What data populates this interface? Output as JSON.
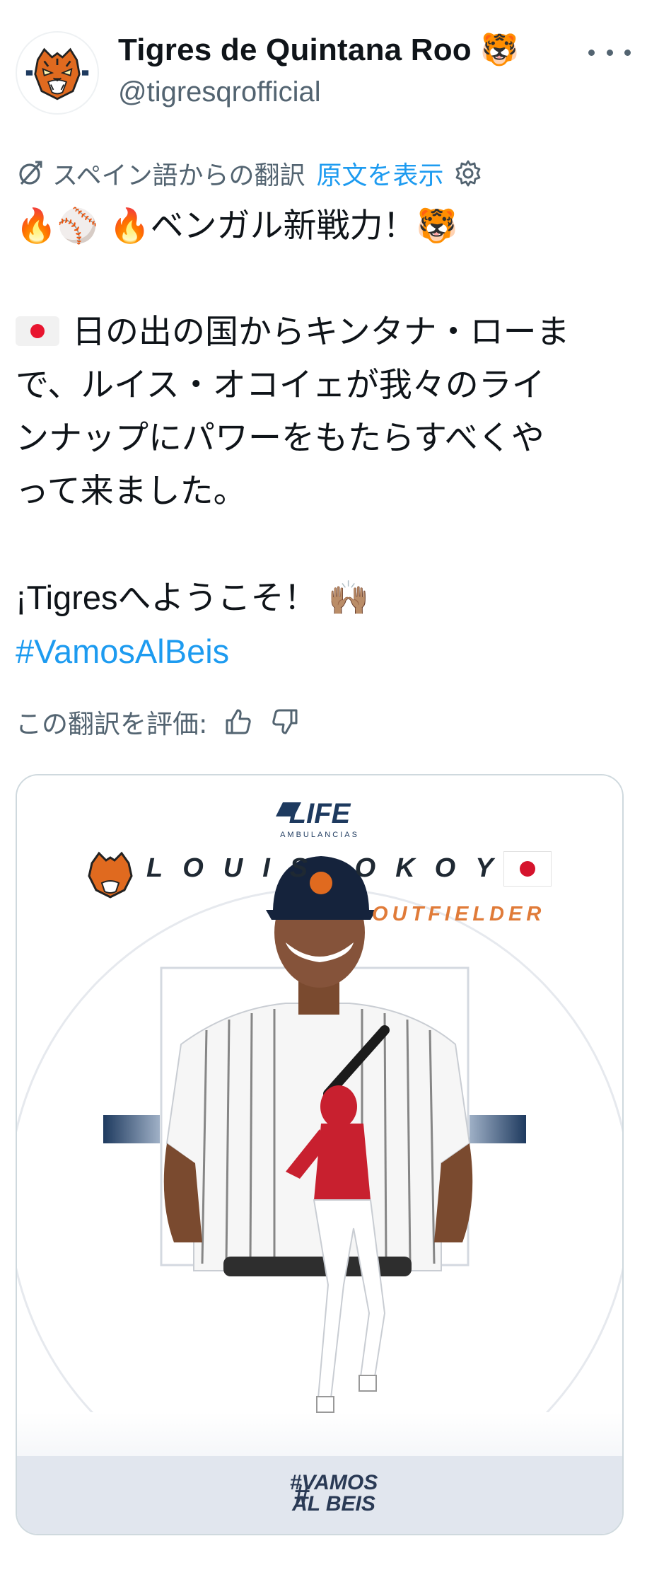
{
  "account": {
    "display_name": "Tigres de Quintana Roo 🐯",
    "handle": "@tigresqrofficial",
    "avatar_icon": "tiger-logo-icon",
    "more_icon": "more-options-icon"
  },
  "translation": {
    "label": "スペイン語からの翻訳",
    "show_original": "原文を表示",
    "settings_icon": "gear-icon",
    "translate_icon": "translate-icon"
  },
  "tweet": {
    "line1": "🔥⚾ 🔥ベンガル新戦力！🐯",
    "line2": "日の出の国からキンタナ・ローま",
    "line3": "で、ルイス・オコイェが我々のライ",
    "line4": "ンナップにパワーをもたらすべくや",
    "line5": "って来ました。",
    "welcome_prefix": "¡Tigres",
    "welcome_text": "へようこそ！",
    "welcome_emoji": "🙌🏽",
    "hashtag": "#VamosAlBeis"
  },
  "rating": {
    "label": "この翻訳を評価:",
    "thumbs_up_icon": "thumbs-up-icon",
    "thumbs_down_icon": "thumbs-down-icon"
  },
  "media": {
    "sponsor": "LIFE",
    "sponsor_sub": "AMBULANCIAS",
    "player_name": "LOUIS OKOYE",
    "position": "OUTFIELDER",
    "tag_line1": "#VAMOS",
    "tag_line2": "AL BEIS",
    "colors": {
      "navy": "#1e3a5f",
      "orange": "#e07b39",
      "red_jersey": "#c8202f"
    }
  }
}
